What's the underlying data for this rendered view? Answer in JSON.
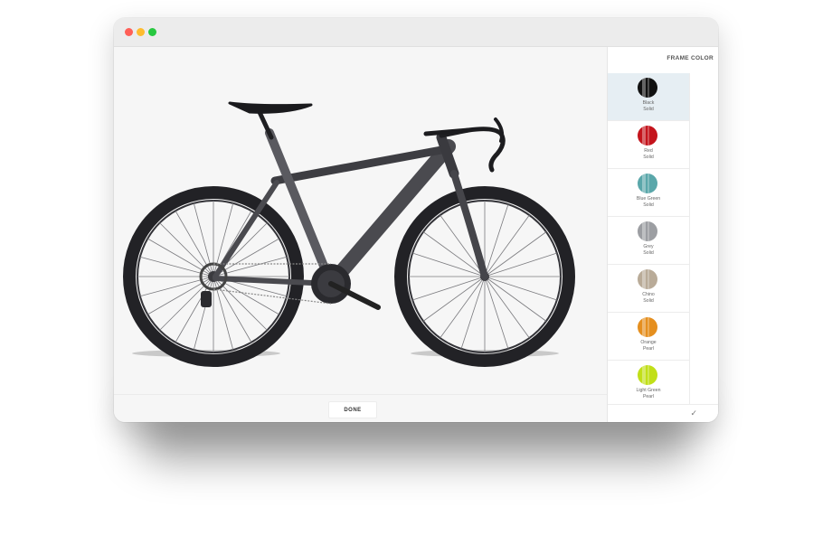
{
  "window": {
    "traffic_lights": {
      "close": "#ff5f57",
      "minimize": "#febc2e",
      "zoom": "#28c840"
    }
  },
  "sidebar": {
    "title": "FRAME COLOR",
    "colors": [
      {
        "name": "Black",
        "finish": "Solid",
        "hex": "#111111",
        "selected": true
      },
      {
        "name": "Red",
        "finish": "Solid",
        "hex": "#c4141c",
        "selected": false
      },
      {
        "name": "Blue Green",
        "finish": "Solid",
        "hex": "#5aa7aa",
        "selected": false
      },
      {
        "name": "Grey",
        "finish": "Solid",
        "hex": "#9c9ea2",
        "selected": false
      },
      {
        "name": "Chino",
        "finish": "Solid",
        "hex": "#b9ab98",
        "selected": false
      },
      {
        "name": "Orange",
        "finish": "Pearl",
        "hex": "#e58f1f",
        "selected": false
      },
      {
        "name": "Light Green",
        "finish": "Pearl",
        "hex": "#c1df18",
        "selected": false
      }
    ],
    "confirm_icon": "checkmark-icon"
  },
  "footer": {
    "done_label": "DONE"
  },
  "bike": {
    "frame_color": "#4a4a4f",
    "wheel_color": "#1d1d20"
  }
}
